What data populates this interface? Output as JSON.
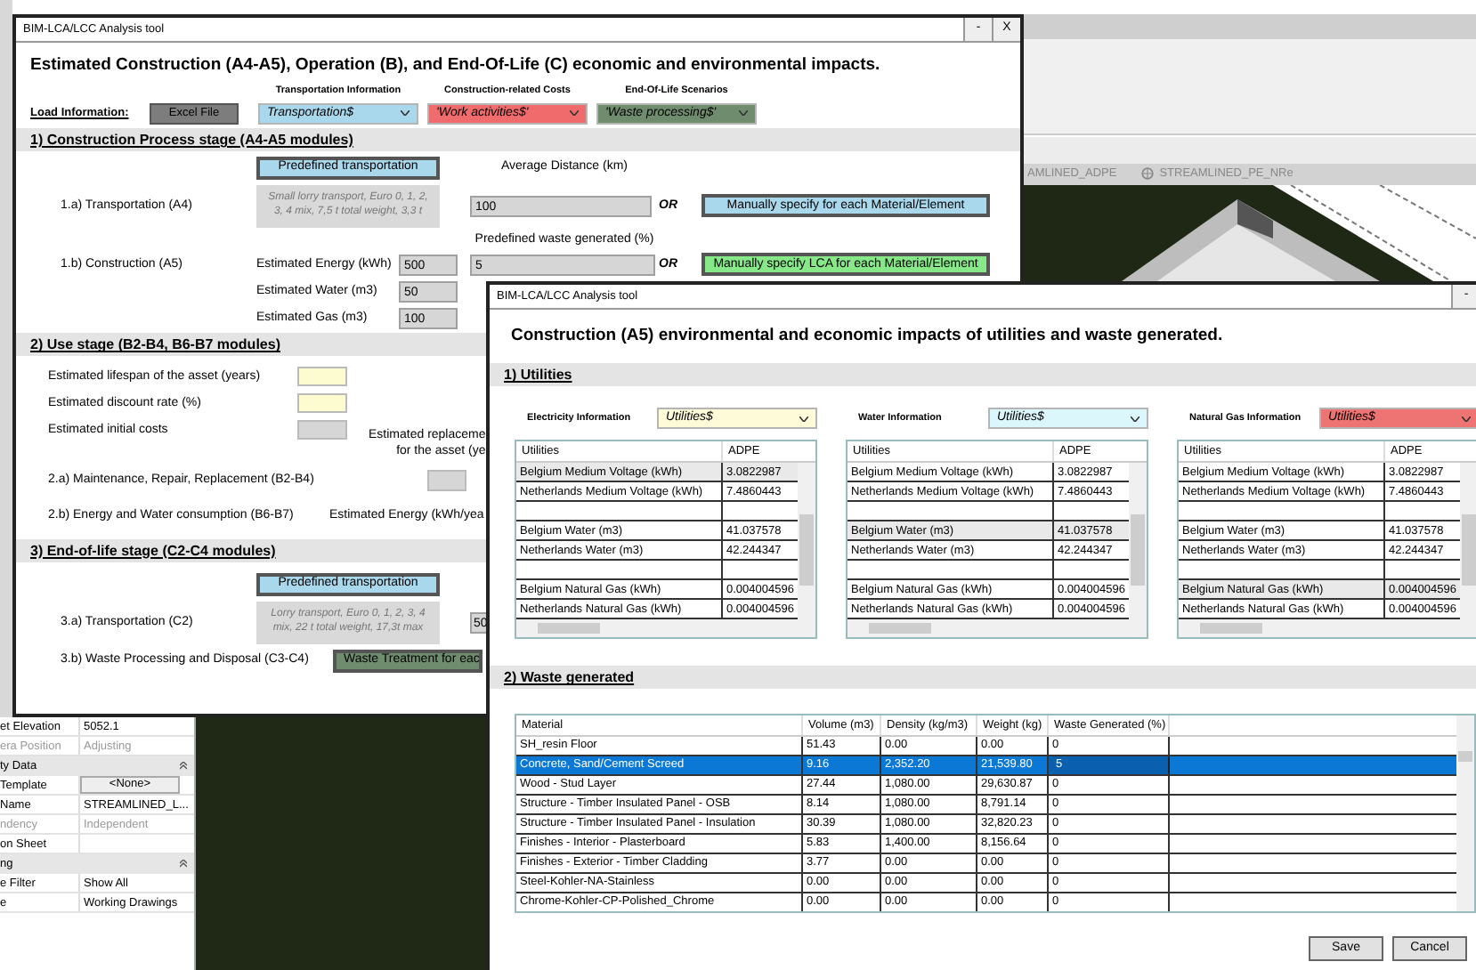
{
  "background": {
    "view_tabs": [
      {
        "label": "AMLINED_ADPE",
        "kind": "plain"
      },
      {
        "label": "STREAMLINED_PE_NRe",
        "kind": "icon"
      }
    ],
    "properties": [
      {
        "kind": "row",
        "label": "et Elevation",
        "value": "5052.1",
        "disabled": false
      },
      {
        "kind": "row",
        "label": "era Position",
        "value": "Adjusting",
        "disabled": true
      },
      {
        "kind": "section",
        "label": "ty Data"
      },
      {
        "kind": "button",
        "label": "Template",
        "value": "<None>"
      },
      {
        "kind": "row",
        "label": "Name",
        "value": "STREAMLINED_L...",
        "disabled": false
      },
      {
        "kind": "row",
        "label": "ndency",
        "value": "Independent",
        "disabled": true
      },
      {
        "kind": "row",
        "label": "on Sheet",
        "disabled": false
      },
      {
        "kind": "section",
        "label": "ng"
      },
      {
        "kind": "row",
        "label": "e Filter",
        "value": "Show All",
        "disabled": false
      },
      {
        "kind": "row",
        "label": "e",
        "value": "Working Drawings",
        "disabled": false
      }
    ]
  },
  "main_window": {
    "title": "BIM-LCA/LCC Analysis tool",
    "window_buttons": [
      "-",
      "X"
    ],
    "heading": "Estimated Construction (A4-A5), Operation (B), and End-Of-Life (C) economic and environmental impacts.",
    "load": {
      "label": "Load Information:",
      "button": "Excel File",
      "sources": [
        {
          "caption": "Transportation Information",
          "value": "Transportation$",
          "color": "#a9d8ec"
        },
        {
          "caption": "Construction-related Costs",
          "value": "'Work activities$'",
          "color": "#f06b6b"
        },
        {
          "caption": "End-Of-Life Scenarios",
          "value": "'Waste processing$'",
          "color": "#6f8c6f"
        }
      ]
    },
    "construction": {
      "title": "1) Construction Process stage (A4-A5 modules)",
      "predefined_button": "Predefined transportation",
      "distance_label": "Average Distance (km)",
      "transport_label": "1.a) Transportation (A4)",
      "transport_description": [
        "Small lorry transport, Euro 0, 1, 2,",
        "3, 4 mix, 7,5 t total weight, 3,3 t"
      ],
      "distance_value": "100",
      "or_labels": [
        "OR",
        "OR"
      ],
      "manual_transport_button": "Manually specify for each Material/Element",
      "waste_label": "Predefined waste generated (%)",
      "construction_label": "1.b) Construction (A5)",
      "inputs": [
        {
          "label": "Estimated Energy (kWh)",
          "value": "500"
        },
        {
          "label": "Estimated Water (m3)",
          "value": "50"
        },
        {
          "label": "Estimated Gas (m3)",
          "value": "100"
        }
      ],
      "waste_value": "5",
      "manual_lca_button": "Manually specify LCA for each Material/Element"
    },
    "use": {
      "title": "2) Use stage (B2-B4, B6-B7 modules)",
      "lifespan_label": "Estimated lifespan of the asset (years)",
      "discount_label": "Estimated discount rate (%)",
      "initial_costs_label": "Estimated initial costs",
      "replacement_label": [
        "Estimated replaceme",
        "for the asset (ye"
      ],
      "maintenance_label": "2.a) Maintenance, Repair, Replacement (B2-B4)",
      "energy_label": "2.b) Energy and Water consumption (B6-B7)",
      "energy_estimate_label": "Estimated Energy (kWh/yea"
    },
    "end_of_life": {
      "title": "3) End-of-life stage (C2-C4 modules)",
      "predefined_button": "Predefined transportation",
      "transport_label": "3.a) Transportation (C2)",
      "transport_description": [
        "Lorry transport, Euro 0, 1, 2, 3, 4",
        "mix, 22 t total weight, 17,3t max"
      ],
      "distance_value": "50",
      "waste_label": "3.b) Waste Processing and Disposal (C3-C4)",
      "waste_button": "Waste Treatment for eac"
    }
  },
  "utilities_window": {
    "title": "BIM-LCA/LCC Analysis tool",
    "window_buttons": [
      "-"
    ],
    "heading": "Construction (A5) environmental and economic impacts of utilities and waste generated.",
    "utilities": {
      "title": "1) Utilities",
      "groups": [
        {
          "label": "Electricity Information",
          "value": "Utilities$",
          "color": "#fdfbd8",
          "columns": [
            "Utilities",
            "ADPE"
          ],
          "row_groups": [
            [
              {
                "cells": [
                  "Belgium Medium Voltage (kWh)",
                  "3.0822987"
                ],
                "selected": true
              },
              {
                "cells": [
                  "Netherlands Medium Voltage (kWh)",
                  "7.4860443"
                ],
                "selected": false
              }
            ],
            [
              {
                "cells": [
                  "Belgium Water (m3)",
                  "41.037578"
                ],
                "selected": false
              },
              {
                "cells": [
                  "Netherlands Water (m3)",
                  "42.244347"
                ],
                "selected": false
              }
            ],
            [
              {
                "cells": [
                  "Belgium Natural Gas (kWh)",
                  "0.004004596"
                ],
                "selected": false
              },
              {
                "cells": [
                  "Netherlands Natural Gas (kWh)",
                  "0.004004596"
                ],
                "selected": false
              }
            ]
          ]
        },
        {
          "label": "Water Information",
          "value": "Utilities$",
          "color": "#dcf7fb",
          "columns": [
            "Utilities",
            "ADPE"
          ],
          "row_groups": [
            [
              {
                "cells": [
                  "Belgium Medium Voltage (kWh)",
                  "3.0822987"
                ],
                "selected": false
              },
              {
                "cells": [
                  "Netherlands Medium Voltage (kWh)",
                  "7.4860443"
                ],
                "selected": false
              }
            ],
            [
              {
                "cells": [
                  "Belgium Water (m3)",
                  "41.037578"
                ],
                "selected": true
              },
              {
                "cells": [
                  "Netherlands Water (m3)",
                  "42.244347"
                ],
                "selected": false
              }
            ],
            [
              {
                "cells": [
                  "Belgium Natural Gas (kWh)",
                  "0.004004596"
                ],
                "selected": false
              },
              {
                "cells": [
                  "Netherlands Natural Gas (kWh)",
                  "0.004004596"
                ],
                "selected": false
              }
            ]
          ]
        },
        {
          "label": "Natural Gas Information",
          "value": "Utilities$",
          "color": "#ee7373",
          "columns": [
            "Utilities",
            "ADPE"
          ],
          "row_groups": [
            [
              {
                "cells": [
                  "Belgium Medium Voltage (kWh)",
                  "3.0822987"
                ],
                "selected": false
              },
              {
                "cells": [
                  "Netherlands Medium Voltage (kWh)",
                  "7.4860443"
                ],
                "selected": false
              }
            ],
            [
              {
                "cells": [
                  "Belgium Water (m3)",
                  "41.037578"
                ],
                "selected": false
              },
              {
                "cells": [
                  "Netherlands Water (m3)",
                  "42.244347"
                ],
                "selected": false
              }
            ],
            [
              {
                "cells": [
                  "Belgium Natural Gas (kWh)",
                  "0.004004596"
                ],
                "selected": true
              },
              {
                "cells": [
                  "Netherlands Natural Gas (kWh)",
                  "0.004004596"
                ],
                "selected": false
              }
            ]
          ]
        }
      ]
    },
    "waste": {
      "title": "2) Waste generated",
      "columns": [
        "Material",
        "Volume (m3)",
        "Density (kg/m3)",
        "Weight (kg)",
        "Waste Generated (%)"
      ],
      "rows": [
        {
          "cells": [
            "SH_resin Floor",
            "51.43",
            "0.00",
            "0.00",
            "0"
          ],
          "selected": false
        },
        {
          "cells": [
            "Concrete, Sand/Cement Screed",
            "9.16",
            "2,352.20",
            "21,539.80",
            "5"
          ],
          "selected": true
        },
        {
          "cells": [
            "Wood - Stud Layer",
            "27.44",
            "1,080.00",
            "29,630.87",
            "0"
          ],
          "selected": false
        },
        {
          "cells": [
            "Structure - Timber Insulated Panel - OSB",
            "8.14",
            "1,080.00",
            "8,791.14",
            "0"
          ],
          "selected": false
        },
        {
          "cells": [
            "Structure - Timber Insulated Panel - Insulation",
            "30.39",
            "1,080.00",
            "32,820.23",
            "0"
          ],
          "selected": false
        },
        {
          "cells": [
            "Finishes - Interior - Plasterboard",
            "5.83",
            "1,400.00",
            "8,156.64",
            "0"
          ],
          "selected": false
        },
        {
          "cells": [
            "Finishes - Exterior - Timber Cladding",
            "3.77",
            "0.00",
            "0.00",
            "0"
          ],
          "selected": false
        },
        {
          "cells": [
            "Steel-Kohler-NA-Stainless",
            "0.00",
            "0.00",
            "0.00",
            "0"
          ],
          "selected": false
        },
        {
          "cells": [
            "Chrome-Kohler-CP-Polished_Chrome",
            "0.00",
            "0.00",
            "0.00",
            "0"
          ],
          "selected": false
        }
      ]
    },
    "buttons": [
      "Save",
      "Cancel"
    ]
  }
}
